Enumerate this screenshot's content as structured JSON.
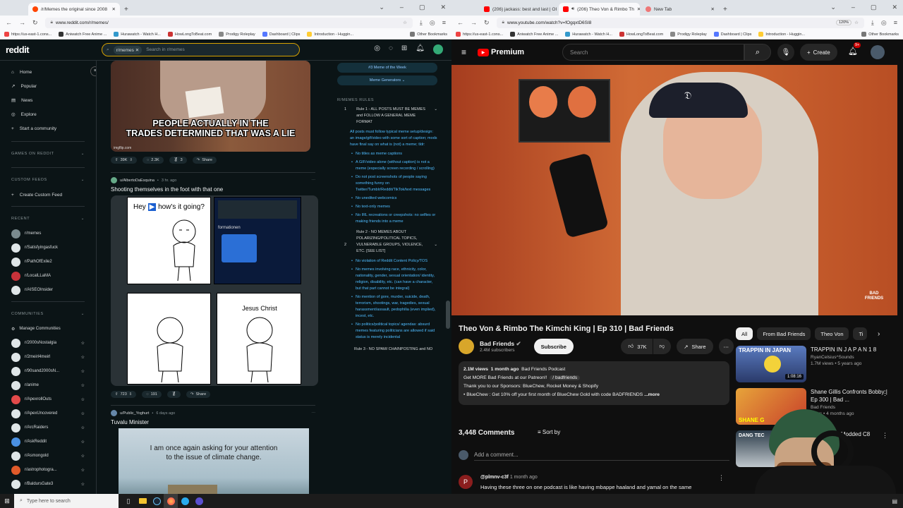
{
  "left_browser": {
    "tab1": "/r/Memes the original since 2008",
    "url": "www.reddit.com/r/memes/",
    "bookmarks": [
      "https://us-east-1.cons...",
      "Aniwatch Free Anime ...",
      "Hurawatch - Watch H...",
      "HowLongToBeat.com",
      "Prodigy Roleplay",
      "Dashboard | Clips",
      "Introduction - Huggin...",
      "Other Bookmarks"
    ]
  },
  "right_browser": {
    "tab1": "(206) jackass: best and last | OI",
    "tab2": "(206) Theo Von & Rimbo Th",
    "tab3": "New Tab",
    "url": "www.youtube.com/watch?v=fOgqxtD6SI8",
    "zoom": "120%",
    "bookmarks": [
      "https://us-east-1.cons...",
      "Aniwatch Free Anime ...",
      "Hurawatch - Watch H...",
      "HowLongToBeat.com",
      "Prodigy Roleplay",
      "Dashboard | Clips",
      "Introduction - Huggin...",
      "Other Bookmarks"
    ]
  },
  "reddit": {
    "logo": "reddit",
    "search_chip": "r/memes",
    "search_placeholder": "Search in r/memes",
    "nav": [
      "Home",
      "Popular",
      "News",
      "Explore",
      "Start a community"
    ],
    "games_header": "GAMES ON REDDIT",
    "custom_header": "CUSTOM FEEDS",
    "create_feed": "Create Custom Feed",
    "recent_header": "RECENT",
    "recent": [
      "r/memes",
      "r/Satisfyingasfuck",
      "r/PathOfExile2",
      "r/LocalLLaMA",
      "r/AISEOInsider"
    ],
    "communities_header": "COMMUNITIES",
    "manage": "Manage Communities",
    "communities": [
      "r/2000sNostalgia",
      "r/2meirl4meirl",
      "r/90sand2000sN...",
      "r/anime",
      "r/ApexrollOuts",
      "r/ApexUncovered",
      "r/ArcRaiders",
      "r/AskReddit",
      "r/Asmongold",
      "r/astrophotogra...",
      "r/BaldursGate3",
      "r/battlestations"
    ],
    "post1": {
      "caption_line1": "PEOPLE ACTUALLY IN THE",
      "caption_line2": "TRADES DETERMINED THAT WAS A LIE",
      "watermark": "imgflip.com",
      "votes": "39K",
      "comments": "2.3K",
      "awards": "3",
      "share": "Share"
    },
    "post2": {
      "user": "u/AlbertoDaEsquina",
      "time": "3 hr. ago",
      "title": "Shooting themselves in the foot with that one",
      "panel1_text": "Hey",
      "panel1_text2": "how's it going?",
      "panel4_text": "Jesus Christ",
      "inner_title": "formationen",
      "votes": "723",
      "comments": "191",
      "share": "Share"
    },
    "post3": {
      "user": "u/Public_Yoghurt",
      "time": "6 days ago",
      "title": "Tuvalu Minister",
      "image_text1": "I am once again asking for your attention",
      "image_text2": "to the issue of climate change."
    },
    "side": {
      "meme_of_week": "#3 Meme of the Week",
      "generators": "Meme Generators",
      "rules_header": "R/MEMES RULES",
      "rule1_num": "1",
      "rule1_title": "Rule 1 - ALL POSTS MUST BE MEMES and FOLLOW A GENERAL MEME FORMAT",
      "rule1_body": "All posts must follow typical meme setup/design: an image/gif/video with some sort of caption; mods have final say on what is (not) a meme; tldr:",
      "rule1_items": [
        "No titles as meme captions",
        "A GIF/video alone (without caption) is not a meme (especially screen recording / scrolling)",
        "Do not post screenshots of people saying something funny on Twitter/Tumblr/Reddit/TikTok/text messages",
        "No unedited webcomics",
        "No text-only memes",
        "No IRL recreations or creepshots: no selfies or making friends into a meme"
      ],
      "rule2_num": "2",
      "rule2_title": "Rule 2 - NO MEMES ABOUT POLARIZING/POLITICAL TOPICS, VULNERABLE GROUPS, VIOLENCE, ETC. [SEE LIST]",
      "rule2_items": [
        "No violation of Reddit Content Policy/TOS",
        "No memes involving race, ethnicity, color, nationality, gender, sexual orientation/ identity, religion, disability, etc. (can have a character, but that part cannot be integral)",
        "No mention of gore, murder, suicide, death, terrorism, shootings, war, tragedies, sexual harassment/assault, pedophilia (even implied), incest, etc.",
        "No politics/political topics/ agendas: absurd memes featuring politicians are allowed if said status is merely incidental"
      ],
      "rule3_title": "Rule 3 - NO SPAM/ CHAINPOSTING and NO"
    }
  },
  "youtube": {
    "logo": "Premium",
    "search_placeholder": "Search",
    "create": "Create",
    "notif_count": "9+",
    "watermark": "BAD FRIENDS",
    "title": "Theo Von & Rimbo The Kimchi King | Ep 310 | Bad Friends",
    "channel": "Bad Friends",
    "subs": "2.4M subscribers",
    "subscribe": "Subscribe",
    "likes": "37K",
    "share": "Share",
    "views": "2.1M views",
    "age": "1 month ago",
    "podcast": "Bad Friends Podcast",
    "desc1": "Get MORE Bad Friends at our Patreon!!",
    "desc1_link": "/ badfriends",
    "desc2": "Thank you to our Sponsors: BlueChew, Rocket Money & Shopify",
    "desc3": "• BlueChew : Get 10% off your first month of BlueChew Gold with code BADFRIENDS",
    "more": "...more",
    "comments_count": "3,448 Comments",
    "sort": "Sort by",
    "add_comment": "Add a comment...",
    "c_user": "@plmnv-c3f",
    "c_time": "1 month ago",
    "c_avatar": "P",
    "c_text": "Having these three on one podcast is like having mbappe haaland and yamal on the same",
    "chips": [
      "All",
      "From Bad Friends",
      "Theo Von",
      "Ti"
    ],
    "recs": [
      {
        "title": "TRAPPIN IN J A P A N 1 8",
        "channel": "RyanCelsius^Sounds",
        "meta": "1.7M views • 5 years ago",
        "duration": "1:08:16",
        "thumb_text": "TRAPPIN IN JAPAN"
      },
      {
        "title": "Shane Gillis Confronts Bobby | Ep 300 | Bad ...",
        "channel": "Bad Friends",
        "meta": "views • 4 months ago",
        "thumb_text": "SHANE G"
      },
      {
        "title": "My Modded C8",
        "channel": "",
        "meta": "",
        "thumb_text": "DANG TEC"
      }
    ]
  },
  "taskbar": {
    "search": "Type here to search"
  },
  "colors": {
    "reddit_bg": "#0b1416",
    "yt_bg": "#0f0f0f",
    "yt_red": "#ff0000",
    "video_bg": "#c55b2c"
  }
}
